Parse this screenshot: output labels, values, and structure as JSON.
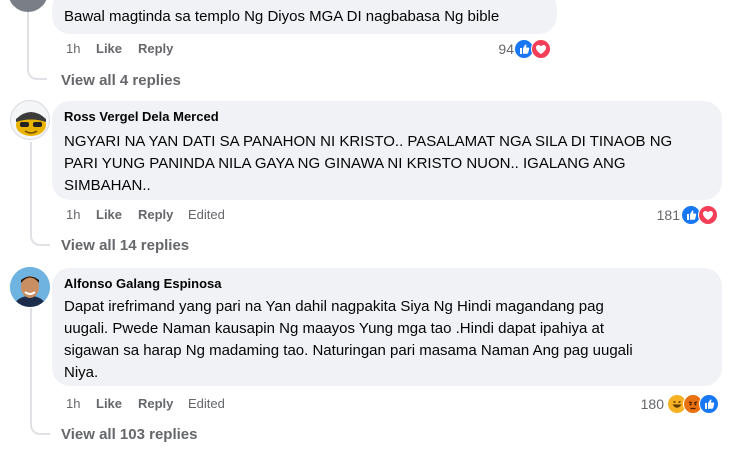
{
  "comments": [
    {
      "author": "",
      "lines": [
        "Bawal magtinda sa templo Ng Diyos MGA DI nagbabasa Ng bible"
      ],
      "time": "1h",
      "like_label": "Like",
      "reply_label": "Reply",
      "edited_label": "",
      "reaction_count": "94",
      "reactions": [
        "like",
        "love"
      ],
      "view_replies": "View all 4 replies"
    },
    {
      "author": "Ross Vergel Dela Merced",
      "lines": [
        "NGYARI NA YAN DATI SA PANAHON NI KRISTO.. PASALAMAT NGA SILA DI TINAOB NG",
        "PARI YUNG PANINDA NILA GAYA NG GINAWA NI KRISTO NUON.. IGALANG ANG",
        "SIMBAHAN.."
      ],
      "time": "1h",
      "like_label": "Like",
      "reply_label": "Reply",
      "edited_label": "Edited",
      "reaction_count": "181",
      "reactions": [
        "like",
        "love"
      ],
      "view_replies": "View all 14 replies"
    },
    {
      "author": "Alfonso Galang Espinosa",
      "lines": [
        "Dapat irefrimand yang pari na Yan dahil nagpakita Siya Ng Hindi magandang pag",
        "uugali. Pwede Naman kausapin Ng maayos Yung mga tao .Hindi dapat ipahiya at",
        "sigawan sa harap Ng madaming tao. Naturingan pari masama Naman Ang pag uugali",
        "Niya."
      ],
      "time": "1h",
      "like_label": "Like",
      "reply_label": "Reply",
      "edited_label": "Edited",
      "reaction_count": "180",
      "reactions": [
        "haha",
        "angry",
        "like"
      ],
      "view_replies": "View all 103 replies"
    }
  ],
  "colors": {
    "bubble": "#f0f2f5",
    "secondary_text": "#65676b",
    "like_blue": "#1877f2",
    "love_red": "#f33e58",
    "haha_yellow": "#f7b125",
    "angry_orange": "#e9710f"
  }
}
